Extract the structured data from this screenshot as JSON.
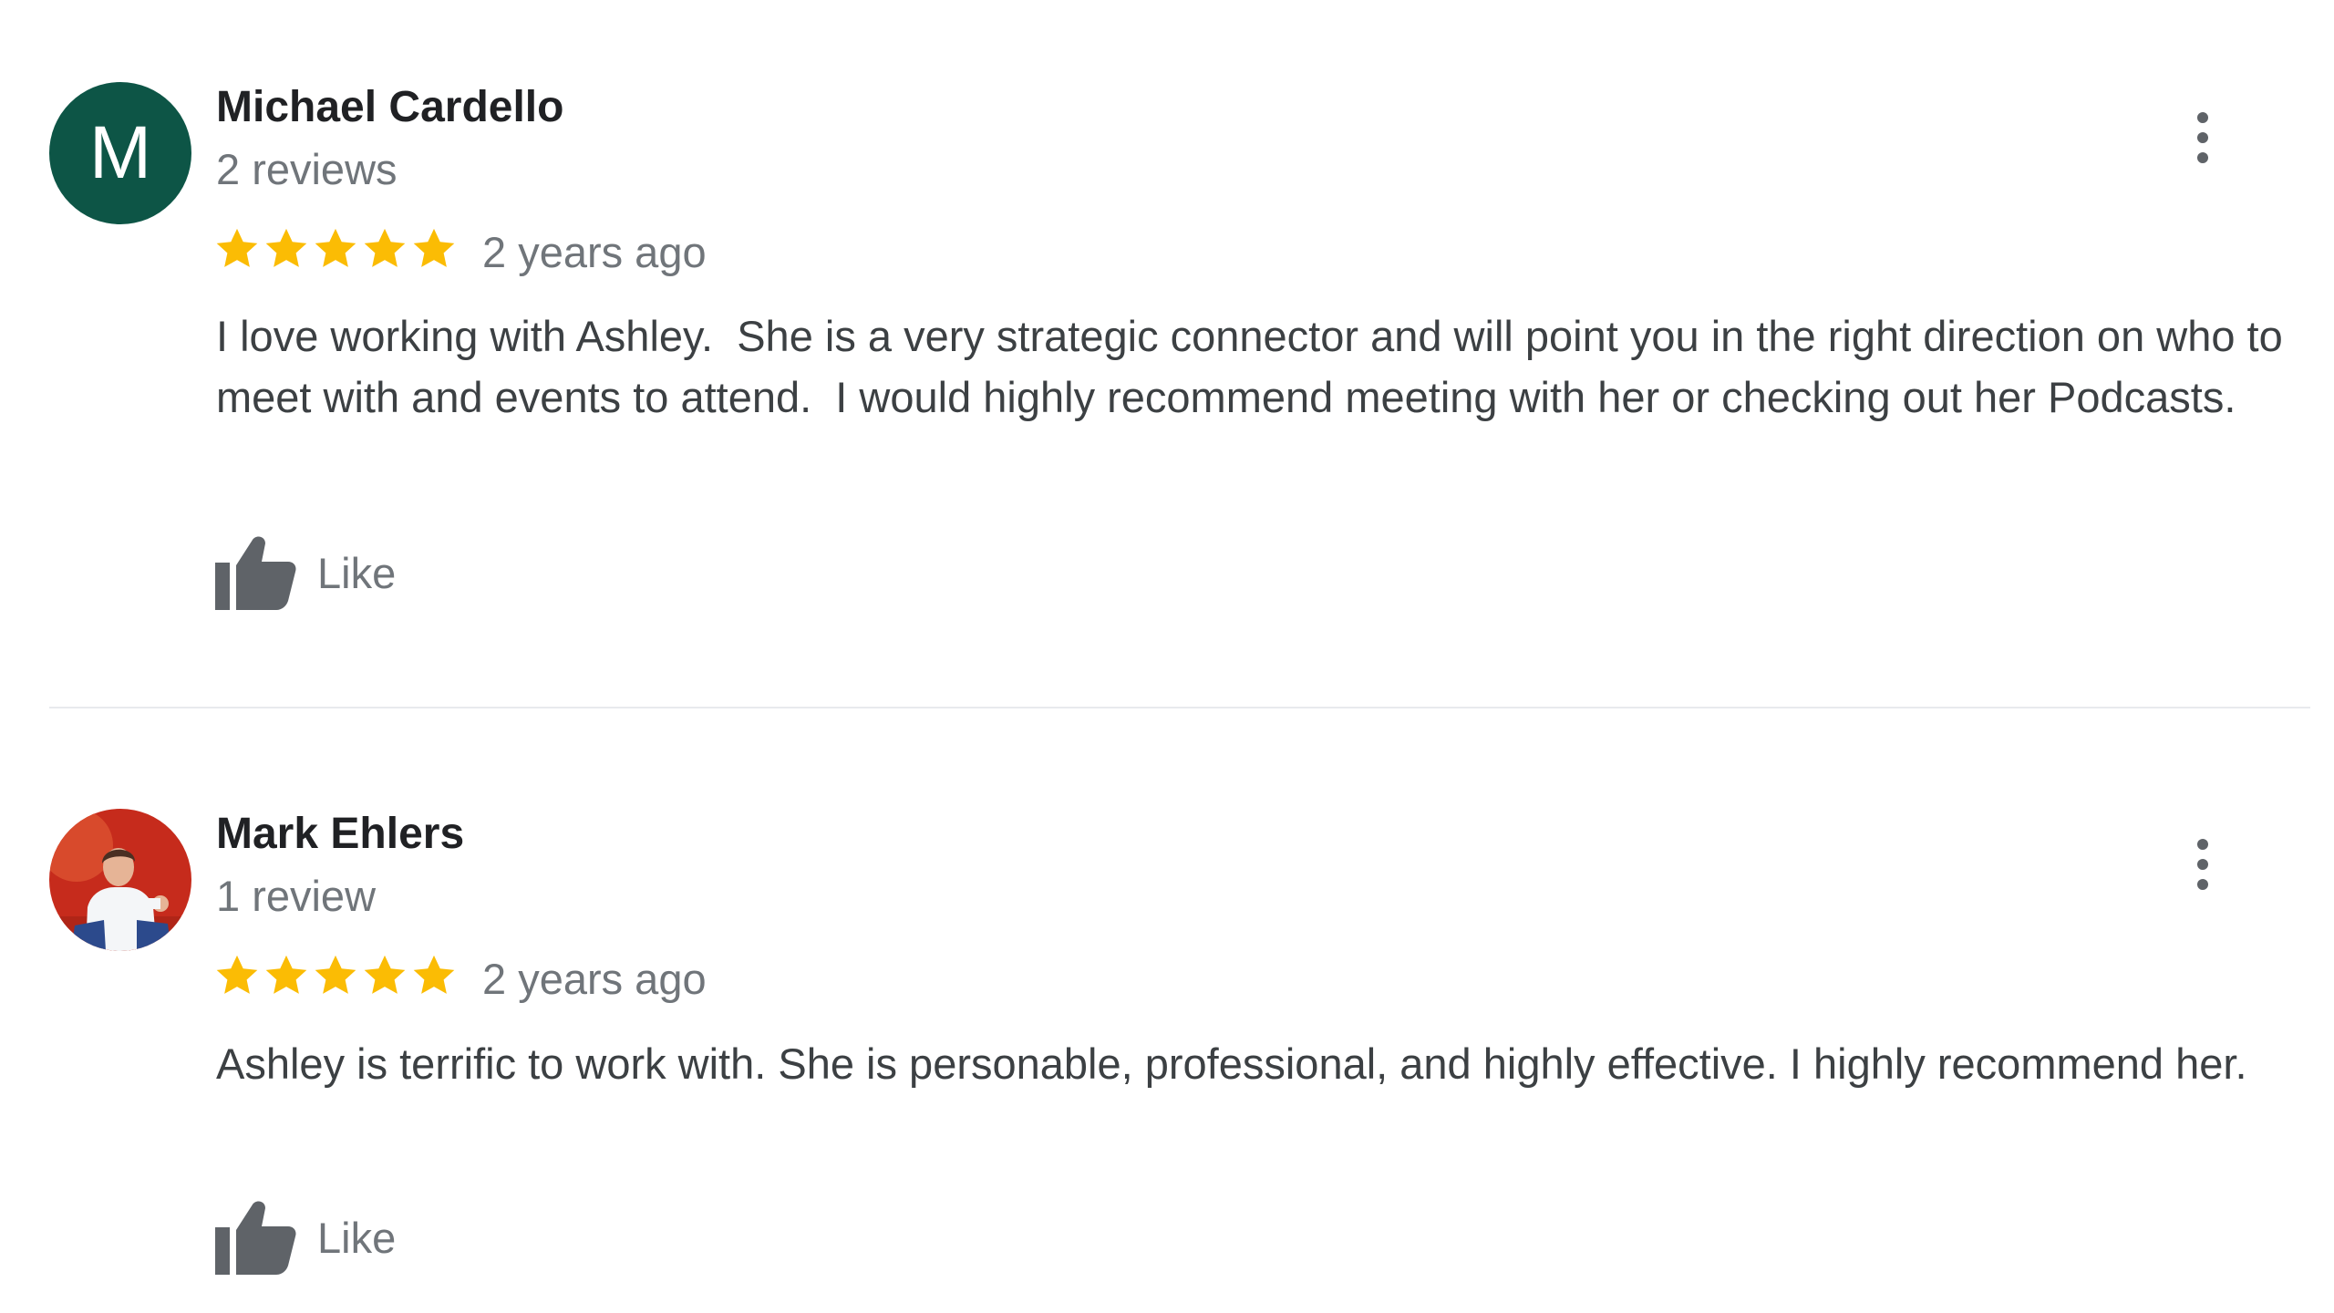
{
  "reviews": [
    {
      "author": "Michael Cardello",
      "avatar_letter": "M",
      "avatar_color": "#0d5546",
      "review_count": "2 reviews",
      "rating": 5,
      "time": "2 years ago",
      "text": "I love working with Ashley.  She is a very strategic connector and will point you in the right direction on who to meet with and events to attend.  I would highly recommend meeting with her or checking out her Podcasts.",
      "like_label": "Like",
      "like_icon": "thumbs-up-icon",
      "menu_icon": "more-vert-icon"
    },
    {
      "author": "Mark Ehlers",
      "avatar_type": "photo",
      "review_count": "1 review",
      "rating": 5,
      "time": "2 years ago",
      "text": "Ashley is terrific to work with. She is personable, professional, and highly effective. I highly recommend her.",
      "like_label": "Like",
      "like_icon": "thumbs-up-icon",
      "menu_icon": "more-vert-icon"
    }
  ],
  "colors": {
    "star": "#fbbc04",
    "avatar_m": "#0d5546",
    "icon": "#5f6368",
    "name": "#202124",
    "secondary_text": "#70757a"
  }
}
